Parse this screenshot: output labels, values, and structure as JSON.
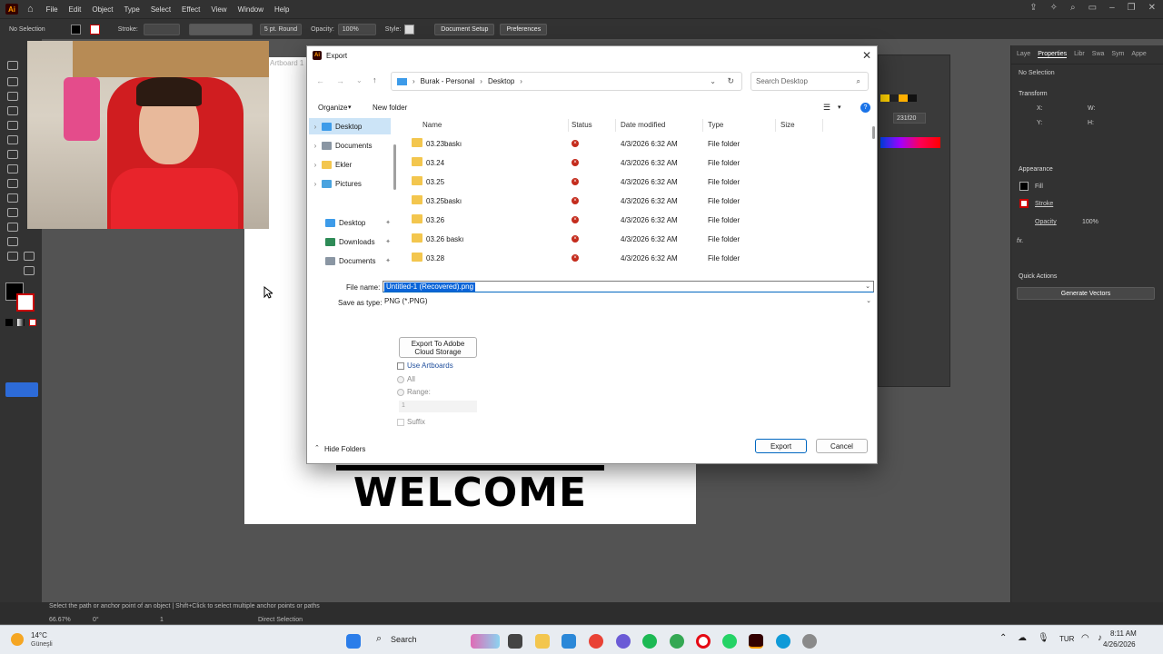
{
  "menubar": {
    "logo": "Ai",
    "items": [
      "File",
      "Edit",
      "Object",
      "Type",
      "Select",
      "Effect",
      "View",
      "Window",
      "Help"
    ]
  },
  "control": {
    "selection": "No Selection",
    "stroke_label": "Stroke:",
    "brush": "5 pt. Round",
    "opacity_label": "Opacity:",
    "opacity_value": "100%",
    "style_label": "Style:",
    "document_setup": "Document Setup",
    "preferences": "Preferences"
  },
  "canvas": {
    "artboard_label": "Artboard 1",
    "welcome_text": "WELCOME"
  },
  "properties": {
    "tabs": [
      "Laye",
      "Properties",
      "Libr",
      "Swa",
      "Sym",
      "Appe"
    ],
    "no_selection": "No Selection",
    "transform": "Transform",
    "x_label": "X:",
    "y_label": "Y:",
    "w_label": "W:",
    "h_label": "H:",
    "appearance": "Appearance",
    "fill": "Fill",
    "stroke": "Stroke",
    "opacity": "Opacity",
    "opacity_value": "100%",
    "fx": "fx.",
    "quick_actions": "Quick Actions",
    "generate_vectors": "Generate Vectors",
    "hex": "231f20"
  },
  "status": {
    "hint": "Select the path or anchor point of an object  |  Shift+Click to select multiple anchor points or paths",
    "zoom": "66.67%",
    "rotation": "0°",
    "artboard_num": "1",
    "tool": "Direct Selection"
  },
  "dialog": {
    "title": "Export",
    "breadcrumb": [
      "Burak - Personal",
      "Desktop"
    ],
    "search_placeholder": "Search Desktop",
    "organize": "Organize",
    "new_folder": "New folder",
    "nav": [
      {
        "label": "Desktop",
        "color": "#3d9be9"
      },
      {
        "label": "Documents",
        "color": "#8a96a3"
      },
      {
        "label": "Ekler",
        "color": "#f3c64e"
      },
      {
        "label": "Pictures",
        "color": "#4aa3df"
      }
    ],
    "quick": [
      {
        "label": "Desktop",
        "color": "#3d9be9"
      },
      {
        "label": "Downloads",
        "color": "#2e8b57"
      },
      {
        "label": "Documents",
        "color": "#8a96a3"
      }
    ],
    "columns": {
      "name": "Name",
      "status": "Status",
      "date": "Date modified",
      "type": "Type",
      "size": "Size"
    },
    "files": [
      {
        "name": "03.23baskı",
        "date": "4/3/2026 6:32 AM",
        "type": "File folder"
      },
      {
        "name": "03.24",
        "date": "4/3/2026 6:32 AM",
        "type": "File folder"
      },
      {
        "name": "03.25",
        "date": "4/3/2026 6:32 AM",
        "type": "File folder"
      },
      {
        "name": "03.25baskı",
        "date": "4/3/2026 6:32 AM",
        "type": "File folder"
      },
      {
        "name": "03.26",
        "date": "4/3/2026 6:32 AM",
        "type": "File folder"
      },
      {
        "name": "03.26 baskı",
        "date": "4/3/2026 6:32 AM",
        "type": "File folder"
      },
      {
        "name": "03.28",
        "date": "4/3/2026 6:32 AM",
        "type": "File folder"
      }
    ],
    "file_name_label": "File name:",
    "file_name_value": "Untitled-1 (Recovered).png",
    "save_type_label": "Save as type:",
    "save_type_value": "PNG (*.PNG)",
    "cloud_button": "Export To Adobe Cloud Storage",
    "use_artboards": "Use Artboards",
    "all": "All",
    "range": "Range:",
    "range_value": "1",
    "suffix": "Suffix",
    "hide_folders": "Hide Folders",
    "export": "Export",
    "cancel": "Cancel"
  },
  "taskbar": {
    "weather_temp": "14°C",
    "weather_desc": "Güneşli",
    "search": "Search",
    "lang": "TUR",
    "time": "8:11 AM",
    "date": "4/26/2026"
  }
}
